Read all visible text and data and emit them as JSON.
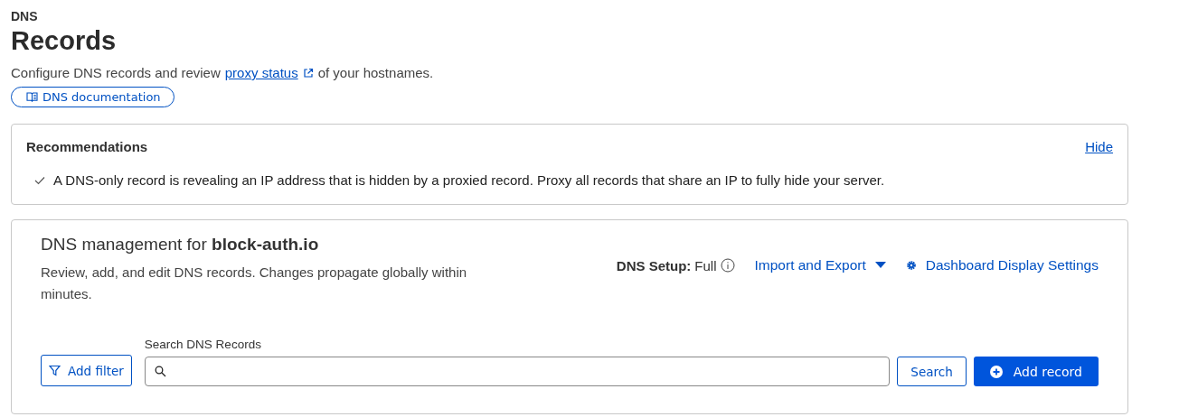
{
  "breadcrumb": "DNS",
  "title": "Records",
  "intro": {
    "before": "Configure DNS records and review",
    "link": "proxy status",
    "after": "of your hostnames."
  },
  "doc_button": "DNS documentation",
  "recommendations": {
    "title": "Recommendations",
    "hide": "Hide",
    "items": [
      {
        "text": "A DNS-only record is revealing an IP address that is hidden by a proxied record. Proxy all records that share an IP to fully hide your server.",
        "checked": true
      }
    ]
  },
  "management": {
    "title": "DNS management for **block-auth.io**",
    "description": "Review, add, and edit DNS records. Changes propagate globally within minutes.",
    "setup_label": "DNS Setup:",
    "setup_value": "Full",
    "import_export": "Import and Export",
    "display_settings": "Dashboard Display Settings",
    "filter_button": "Add filter",
    "search_label": "Search DNS Records",
    "search_button": "Search",
    "add_button": "Add record"
  }
}
